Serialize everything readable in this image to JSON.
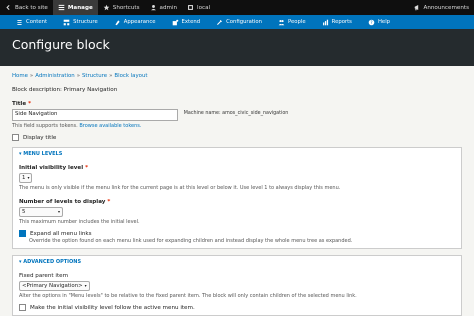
{
  "toolbar": {
    "back": "Back to site",
    "manage": "Manage",
    "shortcuts": "Shortcuts",
    "user": "admin",
    "env": "local",
    "announcements": "Announcements"
  },
  "admin_menu": [
    {
      "label": "Content",
      "icon": "content-icon"
    },
    {
      "label": "Structure",
      "icon": "structure-icon"
    },
    {
      "label": "Appearance",
      "icon": "appearance-icon"
    },
    {
      "label": "Extend",
      "icon": "extend-icon"
    },
    {
      "label": "Configuration",
      "icon": "configuration-icon"
    },
    {
      "label": "People",
      "icon": "people-icon"
    },
    {
      "label": "Reports",
      "icon": "reports-icon"
    },
    {
      "label": "Help",
      "icon": "help-icon"
    }
  ],
  "page_title": "Configure block",
  "breadcrumb": [
    "Home",
    "Administration",
    "Structure",
    "Block layout"
  ],
  "block_description": "Block description: Primary Navigation",
  "title_field": {
    "label": "Title",
    "value": "Side Navigation",
    "machine_name": "Machine name: amos_civic_side_navigation",
    "help_prefix": "This field supports tokens.",
    "help_link": "Browse available tokens."
  },
  "display_title_label": "Display title",
  "menu_levels": {
    "summary": "▾ MENU LEVELS",
    "initial_label": "Initial visibility level",
    "initial_value": "1",
    "initial_desc": "The menu is only visible if the menu link for the current page is at this level or below it. Use level 1 to always display this menu.",
    "depth_label": "Number of levels to display",
    "depth_value": "5",
    "depth_desc": "This maximum number includes the initial level.",
    "expand_label": "Expand all menu links",
    "expand_desc": "Override the option found on each menu link used for expanding children and instead display the whole menu tree as expanded."
  },
  "advanced": {
    "summary": "▾ ADVANCED OPTIONS",
    "parent_label": "Fixed parent item",
    "parent_value": "<Primary Navigation>",
    "parent_desc": "Alter the options in \"Menu levels\" to be relative to the fixed parent item. The block will only contain children of the selected menu link.",
    "follow_label": "Make the initial visibility level follow the active menu item."
  }
}
